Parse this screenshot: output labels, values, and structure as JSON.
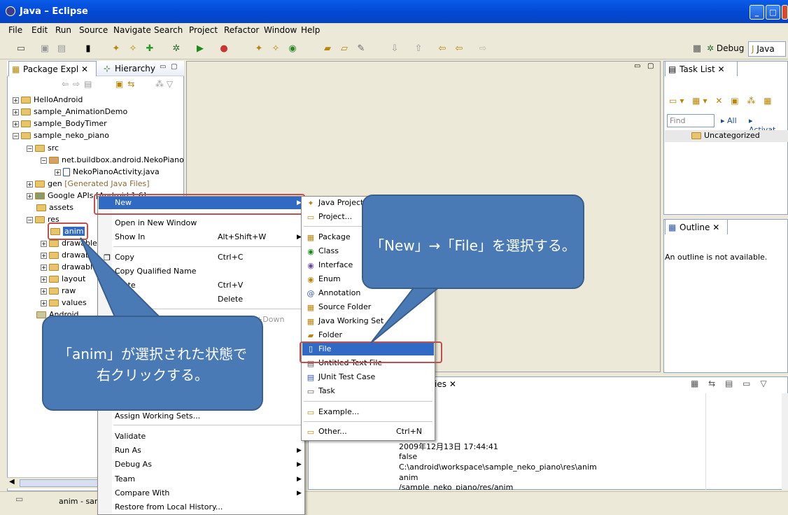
{
  "window": {
    "title": "Java – Eclipse",
    "min": "_",
    "max": "□",
    "close": "X"
  },
  "menubar": [
    "File",
    "Edit",
    "Run",
    "Source",
    "Navigate",
    "Search",
    "Project",
    "Refactor",
    "Window",
    "Help"
  ],
  "perspectives": {
    "debug": "Debug",
    "java": "Java"
  },
  "package_explorer": {
    "tab": "Package Expl",
    "tab2": "Hierarchy",
    "rows": [
      "HelloAndroid",
      "sample_AnimationDemo",
      "sample_BodyTimer",
      "sample_neko_piano",
      "src",
      "net.buildbox.android.NekoPiano",
      "NekoPianoActivity.java",
      "gen",
      "[Generated Java Files]",
      "Google APIs [Android 1.6]",
      "assets",
      "res",
      "anim",
      "drawable",
      "drawable",
      "drawable",
      "layout",
      "raw",
      "values",
      "Android"
    ]
  },
  "task_list": {
    "tab": "Task List",
    "find_placeholder": "Find",
    "all": "All",
    "activate": "Activat...",
    "uncategorized": "Uncategorized"
  },
  "outline": {
    "tab": "Outline",
    "message": "An outline is not available."
  },
  "properties": {
    "tab": "Properties",
    "values": [
      "2009年12月13日 17:44:41",
      "false",
      "C:\\android\\workspace\\sample_neko_piano\\res\\anim",
      "anim",
      "/sample_neko_piano/res/anim"
    ]
  },
  "statusbar": {
    "text": "anim - sam"
  },
  "context_menu": {
    "items": [
      {
        "label": "New",
        "accel": ""
      },
      {
        "label": "Open in New Window",
        "accel": ""
      },
      {
        "label": "Show In",
        "accel": "Alt+Shift+W"
      },
      {
        "label": "Copy",
        "accel": "Ctrl+C"
      },
      {
        "label": "Copy Qualified Name",
        "accel": ""
      },
      {
        "label": "Paste",
        "accel": "Ctrl+V"
      },
      {
        "label": "Delete",
        "accel": "Delete"
      },
      {
        "label": "Assign Working Sets...",
        "accel": ""
      },
      {
        "label": "Validate",
        "accel": ""
      },
      {
        "label": "Run As",
        "accel": ""
      },
      {
        "label": "Debug As",
        "accel": ""
      },
      {
        "label": "Team",
        "accel": ""
      },
      {
        "label": "Compare With",
        "accel": ""
      },
      {
        "label": "Restore from Local History...",
        "accel": ""
      }
    ],
    "hidden_accel": "ift+Down"
  },
  "submenu": {
    "items": [
      "Java Project",
      "Project...",
      "Package",
      "Class",
      "Interface",
      "Enum",
      "Annotation",
      "Source Folder",
      "Java Working Set",
      "Folder",
      "File",
      "Untitled Text File",
      "JUnit Test Case",
      "Task",
      "Example...",
      "Other..."
    ],
    "other_accel": "Ctrl+N"
  },
  "callouts": {
    "right": "「New」→「File」を選択する。",
    "left_line1": "「anim」が選択された状態で",
    "left_line2": "右クリックする。"
  },
  "colors": {
    "titlebar": "#0a5ce8",
    "highlight": "#316ac5",
    "callout": "#4a7ab5",
    "redbox": "#c0504d"
  }
}
